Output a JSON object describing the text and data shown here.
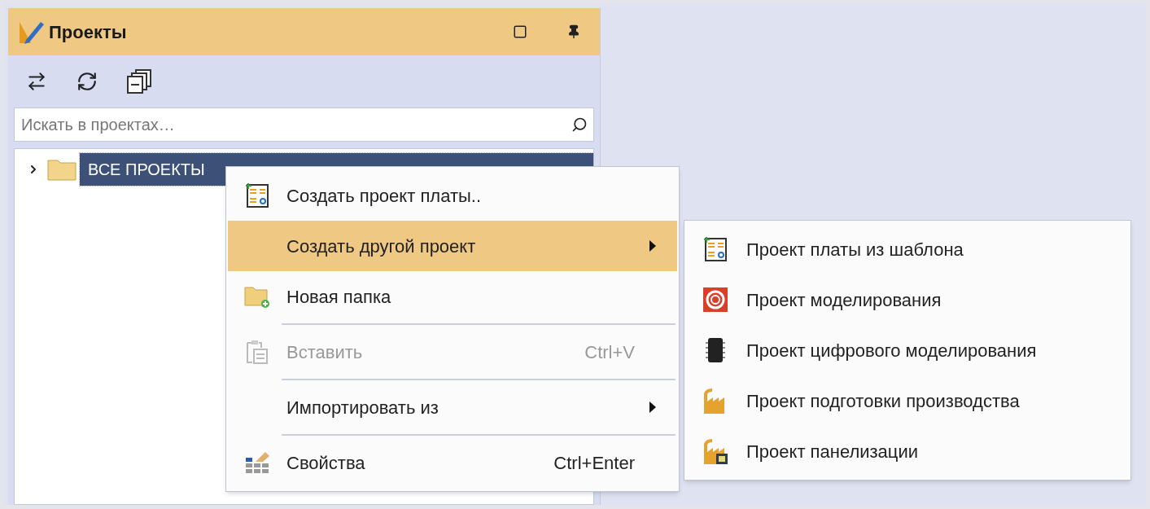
{
  "panel": {
    "title": "Проекты",
    "search": {
      "placeholder": "Искать в проектах…"
    },
    "tree": [
      {
        "label": "ВСЕ ПРОЕКТЫ",
        "expanded": false,
        "selected": true
      }
    ]
  },
  "context_menu": [
    {
      "kind": "item",
      "label": "Создать проект платы..",
      "selected": false,
      "disabled": false,
      "submenu": false
    },
    {
      "kind": "item",
      "label": "Создать другой проект",
      "selected": true,
      "disabled": false,
      "submenu": true
    },
    {
      "kind": "item",
      "label": "Новая папка",
      "selected": false,
      "disabled": false,
      "submenu": false
    },
    {
      "kind": "separator"
    },
    {
      "kind": "item",
      "label": "Вставить",
      "shortcut": "Ctrl+V",
      "selected": false,
      "disabled": true,
      "submenu": false
    },
    {
      "kind": "separator"
    },
    {
      "kind": "item",
      "label": "Импортировать из",
      "selected": false,
      "disabled": false,
      "submenu": true
    },
    {
      "kind": "separator"
    },
    {
      "kind": "item",
      "label": "Свойства",
      "shortcut": "Ctrl+Enter",
      "selected": false,
      "disabled": false,
      "submenu": false
    }
  ],
  "submenu": [
    {
      "label": "Проект платы из шаблона"
    },
    {
      "label": "Проект моделирования"
    },
    {
      "label": "Проект цифрового моделирования"
    },
    {
      "label": "Проект подготовки производства"
    },
    {
      "label": "Проект панелизации"
    }
  ]
}
